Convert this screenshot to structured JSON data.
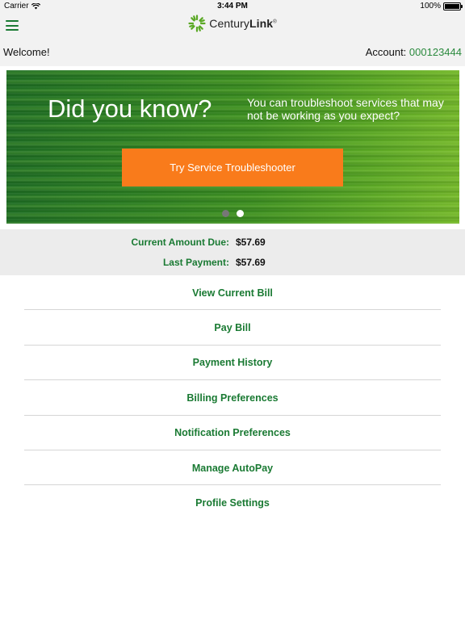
{
  "status_bar": {
    "carrier": "Carrier",
    "time": "3:44 PM",
    "battery": "100%",
    "icons": [
      "wifi-icon",
      "battery-icon"
    ]
  },
  "nav": {
    "menu_icon": "hamburger-menu-icon",
    "logo_name_light": "Century",
    "logo_name_bold": "Link",
    "logo_mark": "®",
    "logo_color": "#5aa824"
  },
  "welcome_bar": {
    "welcome": "Welcome!",
    "account_label": "Account:",
    "account_number": "000123444"
  },
  "banner": {
    "title": "Did you know?",
    "text": "You can troubleshoot services that may not be working as you expect?",
    "button_label": "Try Service Troubleshooter",
    "button_color": "#f97b1b",
    "dots": [
      {
        "active": false
      },
      {
        "active": true
      }
    ]
  },
  "billing_summary": {
    "current_amount_label": "Current Amount Due:",
    "current_amount_value": "$57.69",
    "last_payment_label": "Last Payment:",
    "last_payment_value": "$57.69"
  },
  "menu": {
    "items": [
      {
        "label": "View Current Bill"
      },
      {
        "label": "Pay Bill"
      },
      {
        "label": "Payment History"
      },
      {
        "label": "Billing Preferences"
      },
      {
        "label": "Notification Preferences"
      },
      {
        "label": "Manage AutoPay"
      },
      {
        "label": "Profile Settings"
      }
    ]
  },
  "colors": {
    "accent_green": "#1a7a33",
    "account_green": "#2b8a3e",
    "background": "#ffffff",
    "panel_gray": "#ececec"
  }
}
